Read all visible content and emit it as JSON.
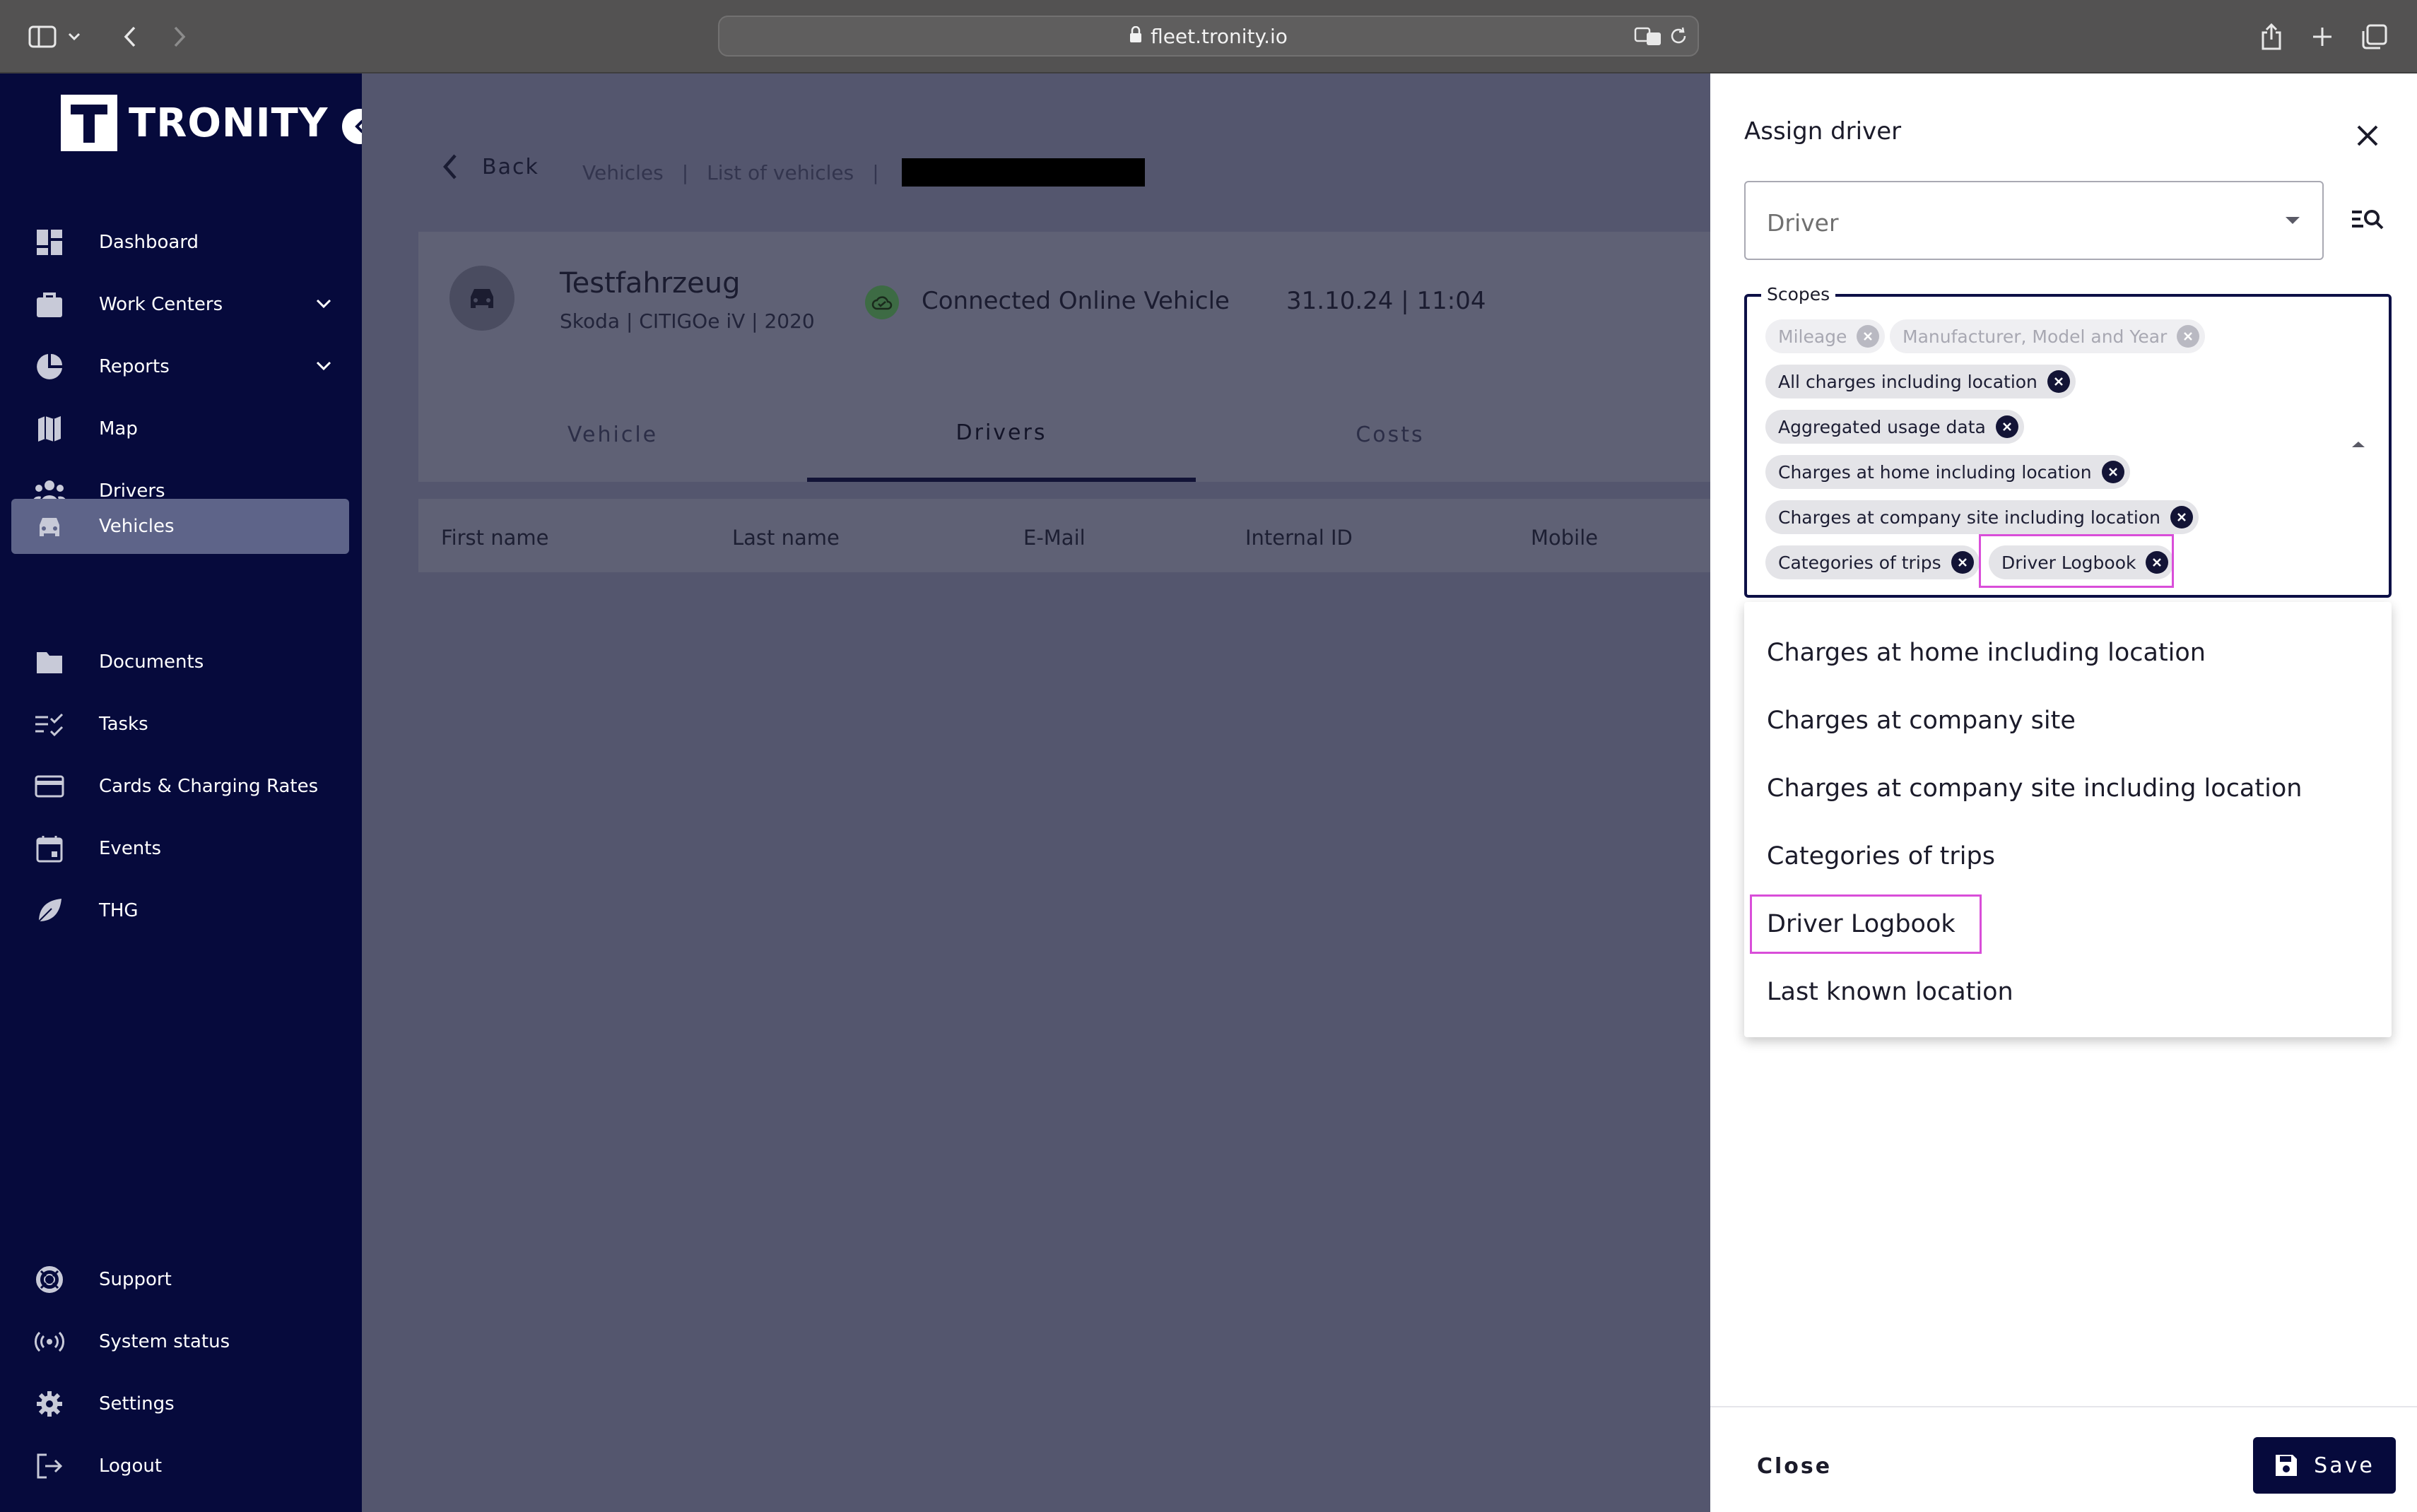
{
  "browser": {
    "url": "fleet.tronity.io"
  },
  "sidebar": {
    "logo_letter": "T",
    "logo_text": "TRONITY",
    "items": [
      {
        "label": "Dashboard",
        "icon": "dashboard-icon"
      },
      {
        "label": "Work Centers",
        "icon": "briefcase-icon",
        "expandable": true
      },
      {
        "label": "Reports",
        "icon": "pie-chart-icon",
        "expandable": true
      },
      {
        "label": "Map",
        "icon": "map-icon"
      },
      {
        "label": "Drivers",
        "icon": "people-icon"
      },
      {
        "label": "Vehicles",
        "icon": "car-icon",
        "active": true
      },
      {
        "label": "Documents",
        "icon": "folder-icon"
      },
      {
        "label": "Tasks",
        "icon": "checklist-icon"
      },
      {
        "label": "Cards & Charging Rates",
        "icon": "card-icon"
      },
      {
        "label": "Events",
        "icon": "calendar-icon"
      },
      {
        "label": "THG",
        "icon": "leaf-icon"
      }
    ],
    "bottom_items": [
      {
        "label": "Support",
        "icon": "lifebuoy-icon"
      },
      {
        "label": "System status",
        "icon": "broadcast-icon"
      },
      {
        "label": "Settings",
        "icon": "gear-icon"
      },
      {
        "label": "Logout",
        "icon": "logout-icon"
      }
    ]
  },
  "main": {
    "back_label": "Back",
    "breadcrumb": [
      "Vehicles",
      "|",
      "List of vehicles",
      "|"
    ],
    "vehicle": {
      "name": "Testfahrzeug",
      "details": "Skoda | CITIGOe iV | 2020",
      "status": "Connected Online Vehicle",
      "timestamp": "31.10.24 | 11:04"
    },
    "tabs": [
      "Vehicle",
      "Drivers",
      "Costs"
    ],
    "active_tab": "Drivers",
    "table_headers": [
      "First name",
      "Last name",
      "E-Mail",
      "Internal ID",
      "Mobile"
    ]
  },
  "drawer": {
    "title": "Assign driver",
    "driver_placeholder": "Driver",
    "scopes_label": "Scopes",
    "chips": [
      {
        "label": "Mileage",
        "disabled": true
      },
      {
        "label": "Manufacturer, Model and Year",
        "disabled": true
      },
      {
        "label": "All charges including location"
      },
      {
        "label": "Aggregated usage data"
      },
      {
        "label": "Charges at home including location"
      },
      {
        "label": "Charges at company site including location"
      },
      {
        "label": "Categories of trips"
      },
      {
        "label": "Driver Logbook",
        "highlighted": true
      }
    ],
    "options": [
      "Charges at home including location",
      "Charges at company site",
      "Charges at company site including location",
      "Categories of trips",
      "Driver Logbook",
      "Last known location"
    ],
    "close_label": "Close",
    "save_label": "Save"
  },
  "colors": {
    "sidebar_bg": "#060a3c",
    "overlay_bg": "#54566e",
    "highlight": "#d94ed9",
    "primary": "#060a3c"
  }
}
